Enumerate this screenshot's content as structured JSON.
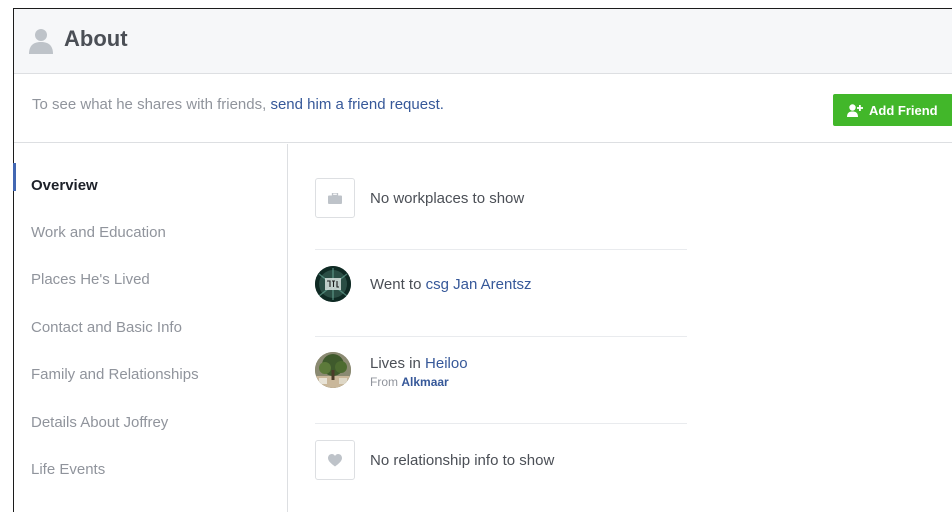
{
  "header": {
    "title": "About",
    "icon": "user-silhouette-icon"
  },
  "notice": {
    "text": "To see what he shares with friends, ",
    "link": "send him a friend request."
  },
  "add_friend": {
    "label": "Add Friend",
    "icon": "add-friend-icon",
    "color": "#42b72a"
  },
  "sidebar": {
    "items": [
      {
        "label": "Overview",
        "active": true
      },
      {
        "label": "Work and Education"
      },
      {
        "label": "Places He's Lived"
      },
      {
        "label": "Contact and Basic Info"
      },
      {
        "label": "Family and Relationships"
      },
      {
        "label": "Details About Joffrey"
      },
      {
        "label": "Life Events"
      }
    ],
    "accent": "#4267b2"
  },
  "overview": {
    "work": {
      "text": "No workplaces to show",
      "icon": "briefcase-icon"
    },
    "education": {
      "prefix": "Went to ",
      "school": "csg Jan Arentsz"
    },
    "lives": {
      "prefix": "Lives in ",
      "city": "Heiloo",
      "from_prefix": "From ",
      "from_city": "Alkmaar"
    },
    "relationship": {
      "text": "No relationship info to show",
      "icon": "heart-icon"
    }
  },
  "colors": {
    "link": "#365899",
    "muted": "#90949c",
    "text": "#1d2129"
  }
}
